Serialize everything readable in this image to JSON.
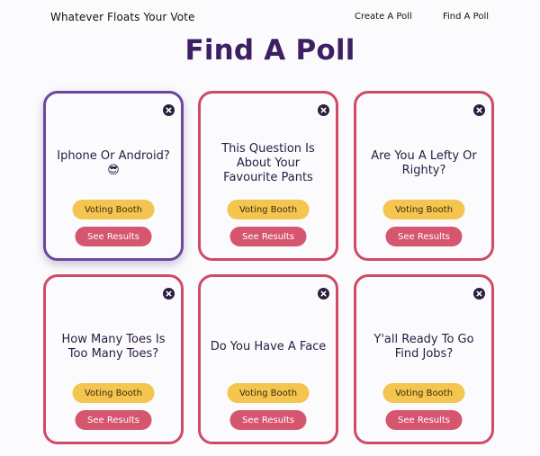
{
  "nav": {
    "brand": "Whatever Floats Your Vote",
    "links": [
      {
        "label": "Create A Poll"
      },
      {
        "label": "Find A Poll"
      }
    ]
  },
  "page": {
    "title": "Find A Poll"
  },
  "colors": {
    "title": "#3d1f63",
    "card_border": "#cf4a64",
    "card_active_border": "#6e45a0",
    "vote_button": "#f4c54f",
    "results_button": "#d5566e",
    "close_icon": "#2b1e3d"
  },
  "polls": [
    {
      "question": "Iphone Or Android?😎",
      "vote_label": "Voting Booth",
      "results_label": "See Results",
      "active": true
    },
    {
      "question": "This Question Is About Your Favourite Pants",
      "vote_label": "Voting Booth",
      "results_label": "See Results",
      "active": false
    },
    {
      "question": "Are You A Lefty Or Righty?",
      "vote_label": "Voting Booth",
      "results_label": "See Results",
      "active": false
    },
    {
      "question": "How Many Toes Is Too Many Toes?",
      "vote_label": "Voting Booth",
      "results_label": "See Results",
      "active": false
    },
    {
      "question": "Do You Have A Face",
      "vote_label": "Voting Booth",
      "results_label": "See Results",
      "active": false
    },
    {
      "question": "Y'all Ready To Go Find Jobs?",
      "vote_label": "Voting Booth",
      "results_label": "See Results",
      "active": false
    }
  ]
}
